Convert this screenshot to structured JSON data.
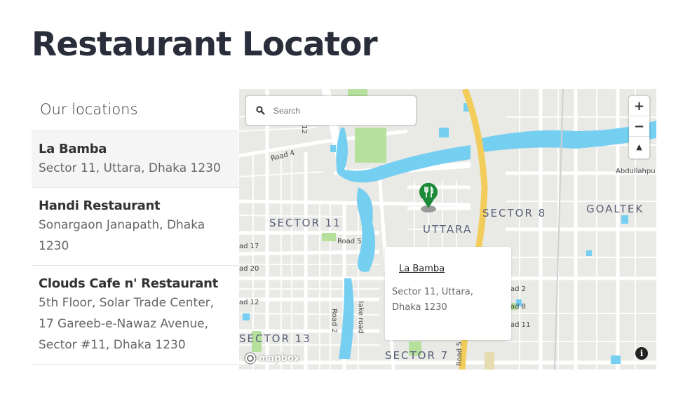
{
  "page": {
    "title": "Restaurant Locator"
  },
  "sidebar": {
    "heading": "Our locations",
    "listings": [
      {
        "title": "La Bamba",
        "address": "Sector 11, Uttara, Dhaka 1230"
      },
      {
        "title": "Handi Restaurant",
        "address": "Sonargaon Janapath, Dhaka 1230"
      },
      {
        "title": "Clouds Cafe n' Restaurant",
        "address": "5th Floor, Solar Trade Center, 17 Gareeb-e-Nawaz Avenue, Sector #11, Dhaka 1230"
      }
    ]
  },
  "map": {
    "search": {
      "placeholder": "Search"
    },
    "zoom_in": "+",
    "zoom_out": "−",
    "compass": "▲",
    "area_labels": [
      "SECTOR 11",
      "UTTARA",
      "SECTOR 8",
      "GOALTEK",
      "SECTOR 13",
      "SECTOR 7"
    ],
    "road_labels": [
      "Road 4",
      "Road 5",
      "Road 2",
      "lake road",
      "Road 5",
      "Abdullahpu",
      "ad 17",
      "ad 20",
      "ad 12",
      "ad 2",
      "ad 8",
      "ad 11",
      "12"
    ],
    "attribution": "mapbox",
    "info": "i",
    "popup": {
      "title": "La Bamba",
      "address": "Sector 11, Uttara, Dhaka 1230"
    },
    "colors": {
      "water": "#75cff0",
      "park": "#b5e19d",
      "highway": "#f2cd5c",
      "land": "#e9e9e6",
      "marker": "#1d8a3a"
    }
  }
}
